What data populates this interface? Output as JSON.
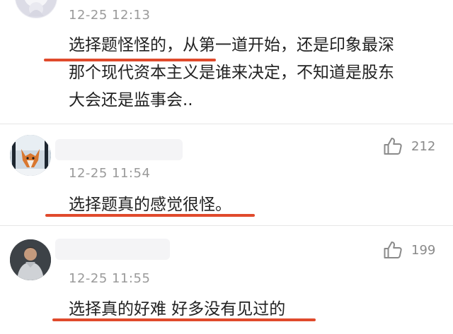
{
  "comments": [
    {
      "time": "12-25 12:13",
      "text": "选择题怪怪的，从第一道开始，还是印象最深\n那个现代资本主义是谁来决定，不知道是股东\n大会还是监事会.."
    },
    {
      "time": "12-25 11:54",
      "text": "选择题真的感觉很怪。",
      "likes": "212"
    },
    {
      "time": "12-25 11:55",
      "text": "选择真的好难 好多没有见过的",
      "likes": "199"
    }
  ],
  "icons": {
    "like": "thumbs-up-icon"
  },
  "colors": {
    "underline": "#e04a2c",
    "meta": "#9a9a9a"
  }
}
